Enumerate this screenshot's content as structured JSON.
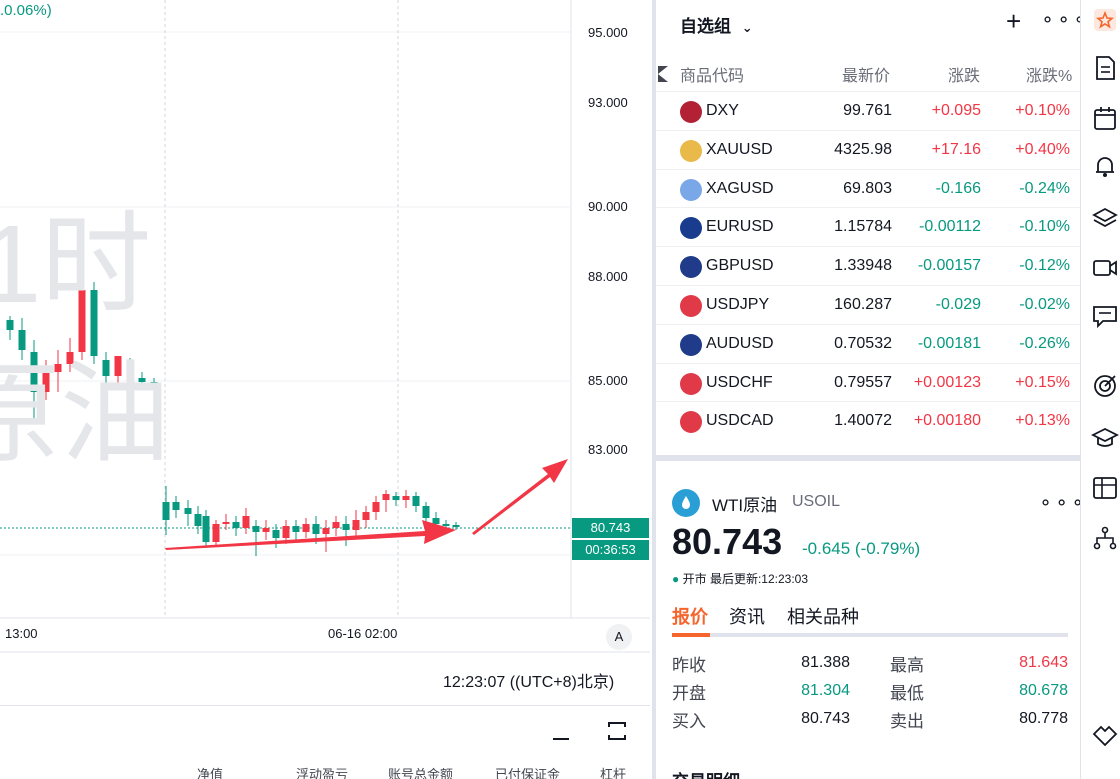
{
  "chart": {
    "percent_top": ".0.06%)",
    "watermark_line1": "1时",
    "watermark_line2": "原油",
    "price_axis": [
      "95.000",
      "93.000",
      "90.000",
      "88.000",
      "85.000",
      "83.000"
    ],
    "current_price": "80.743",
    "countdown": "00:36:53",
    "time_axis": [
      "13:00",
      "06-16 02:00"
    ],
    "auto_scale_label": "A",
    "clock": "12:23:07 ((UTC+8)北京)",
    "bottom_columns": [
      "净值",
      "浮动盈亏",
      "账号总金额",
      "已付保证金",
      "杠杆"
    ],
    "colors": {
      "up": "#f23645",
      "down": "#089981",
      "arrow": "#f23645"
    }
  },
  "watchlist": {
    "title": "自选组",
    "columns": [
      "商品代码",
      "最新价",
      "涨跌",
      "涨跌%"
    ],
    "rows": [
      {
        "symbol": "DXY",
        "last": "99.761",
        "change": "+0.095",
        "change_pct": "+0.10%",
        "dir": "up",
        "icon": "us-flag-icon"
      },
      {
        "symbol": "XAUUSD",
        "last": "4325.98",
        "change": "+17.16",
        "change_pct": "+0.40%",
        "dir": "up",
        "icon": "gold-icon"
      },
      {
        "symbol": "XAGUSD",
        "last": "69.803",
        "change": "-0.166",
        "change_pct": "-0.24%",
        "dir": "down",
        "icon": "silver-icon"
      },
      {
        "symbol": "EURUSD",
        "last": "1.15784",
        "change": "-0.00112",
        "change_pct": "-0.10%",
        "dir": "down",
        "icon": "eu-flag-icon"
      },
      {
        "symbol": "GBPUSD",
        "last": "1.33948",
        "change": "-0.00157",
        "change_pct": "-0.12%",
        "dir": "down",
        "icon": "uk-flag-icon"
      },
      {
        "symbol": "USDJPY",
        "last": "160.287",
        "change": "-0.029",
        "change_pct": "-0.02%",
        "dir": "down",
        "icon": "jp-flag-icon"
      },
      {
        "symbol": "AUDUSD",
        "last": "0.70532",
        "change": "-0.00181",
        "change_pct": "-0.26%",
        "dir": "down",
        "icon": "au-flag-icon"
      },
      {
        "symbol": "USDCHF",
        "last": "0.79557",
        "change": "+0.00123",
        "change_pct": "+0.15%",
        "dir": "up",
        "icon": "ch-flag-icon"
      },
      {
        "symbol": "USDCAD",
        "last": "1.40072",
        "change": "+0.00180",
        "change_pct": "+0.13%",
        "dir": "up",
        "icon": "ca-flag-icon"
      }
    ]
  },
  "detail": {
    "name": "WTI原油",
    "ticker": "USOIL",
    "price": "80.743",
    "change": "-0.645 (-0.79%)",
    "status": "开市",
    "last_update": "最后更新:12:23:03",
    "tabs": [
      "报价",
      "资讯",
      "相关品种"
    ],
    "stats": [
      {
        "label": "昨收",
        "value": "81.388",
        "dir": "neutral"
      },
      {
        "label": "最高",
        "value": "81.643",
        "dir": "up"
      },
      {
        "label": "开盘",
        "value": "81.304",
        "dir": "down"
      },
      {
        "label": "最低",
        "value": "80.678",
        "dir": "down"
      },
      {
        "label": "买入",
        "value": "80.743",
        "dir": "neutral"
      },
      {
        "label": "卖出",
        "value": "80.778",
        "dir": "neutral"
      }
    ],
    "footer": "交易明细"
  }
}
